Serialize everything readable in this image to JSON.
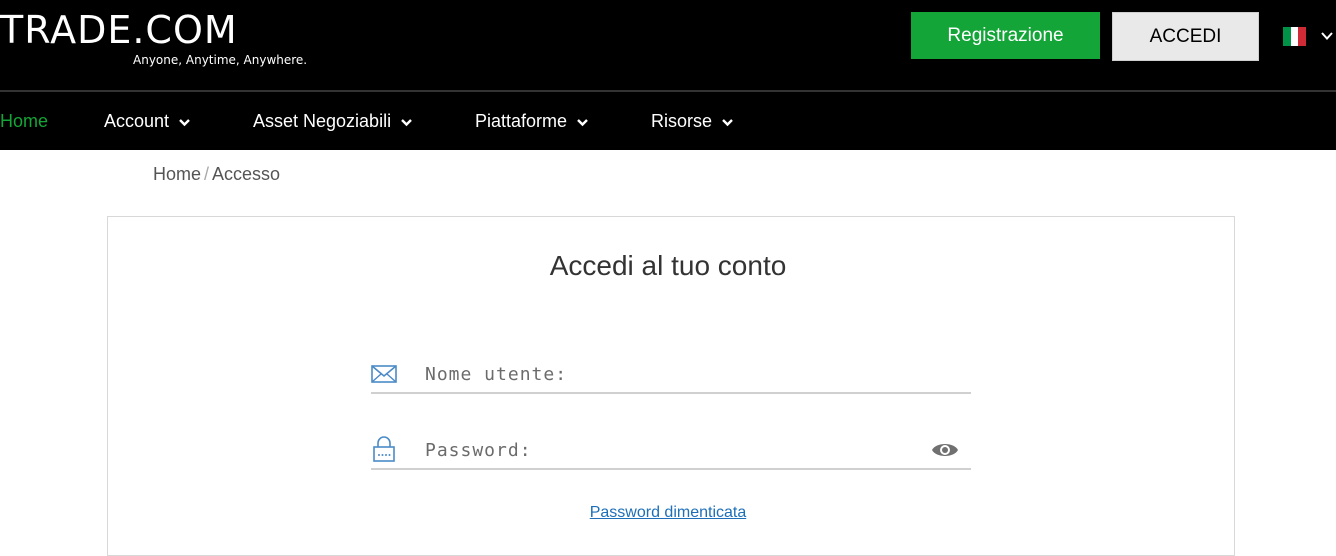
{
  "header": {
    "logo_text": "TRADE.COM",
    "tagline": "Anyone, Anytime, Anywhere.",
    "register_label": "Registrazione",
    "login_label": "ACCEDI",
    "language": {
      "flag_colors": [
        "#009246",
        "#ffffff",
        "#ce2b37"
      ]
    }
  },
  "nav": {
    "items": [
      {
        "label": "Home",
        "active": true
      },
      {
        "label": "Account"
      },
      {
        "label": "Asset Negoziabili"
      },
      {
        "label": "Piattaforme"
      },
      {
        "label": "Risorse"
      }
    ]
  },
  "breadcrumb": {
    "home": "Home",
    "separator": "/",
    "current": "Accesso"
  },
  "login_form": {
    "title": "Accedi al tuo conto",
    "username": {
      "value": "",
      "placeholder": "Nome utente:",
      "icon": "envelope-icon"
    },
    "password": {
      "value": "",
      "placeholder": "Password:",
      "icon": "lock-icon",
      "toggle_icon": "eye-icon"
    },
    "forgot_password": "Password dimenticata"
  },
  "colors": {
    "header_bg": "#000000",
    "accent_green": "#13a538",
    "icon_blue": "#4a8bc7",
    "link_blue": "#1d6fb8"
  }
}
